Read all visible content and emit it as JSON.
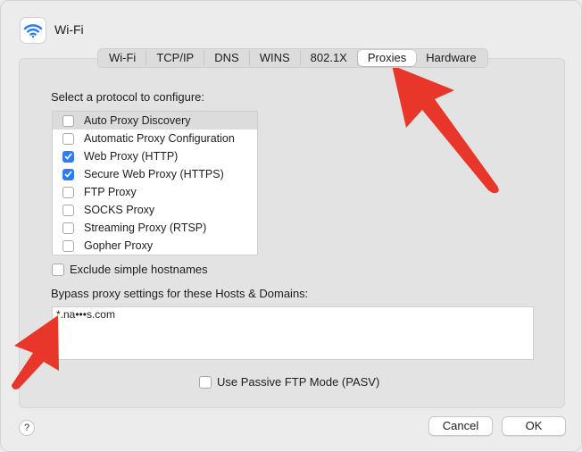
{
  "window": {
    "title": "Wi-Fi",
    "icon": "wifi-icon"
  },
  "tabs": [
    {
      "label": "Wi-Fi",
      "active": false
    },
    {
      "label": "TCP/IP",
      "active": false
    },
    {
      "label": "DNS",
      "active": false
    },
    {
      "label": "WINS",
      "active": false
    },
    {
      "label": "802.1X",
      "active": false
    },
    {
      "label": "Proxies",
      "active": true
    },
    {
      "label": "Hardware",
      "active": false
    }
  ],
  "protocols": {
    "label": "Select a protocol to configure:",
    "items": [
      {
        "label": "Auto Proxy Discovery",
        "checked": false,
        "selected": true
      },
      {
        "label": "Automatic Proxy Configuration",
        "checked": false,
        "selected": false
      },
      {
        "label": "Web Proxy (HTTP)",
        "checked": true,
        "selected": false
      },
      {
        "label": "Secure Web Proxy (HTTPS)",
        "checked": true,
        "selected": false
      },
      {
        "label": "FTP Proxy",
        "checked": false,
        "selected": false
      },
      {
        "label": "SOCKS Proxy",
        "checked": false,
        "selected": false
      },
      {
        "label": "Streaming Proxy (RTSP)",
        "checked": false,
        "selected": false
      },
      {
        "label": "Gopher Proxy",
        "checked": false,
        "selected": false
      }
    ]
  },
  "exclude_simple": {
    "label": "Exclude simple hostnames",
    "checked": false
  },
  "bypass": {
    "label": "Bypass proxy settings for these Hosts & Domains:",
    "value": "*.na•••s.com"
  },
  "passive_ftp": {
    "label": "Use Passive FTP Mode (PASV)",
    "checked": false
  },
  "footer": {
    "help_label": "?",
    "cancel_label": "Cancel",
    "ok_label": "OK"
  },
  "colors": {
    "accent": "#2e7bf6",
    "arrow": "#e8362a"
  }
}
